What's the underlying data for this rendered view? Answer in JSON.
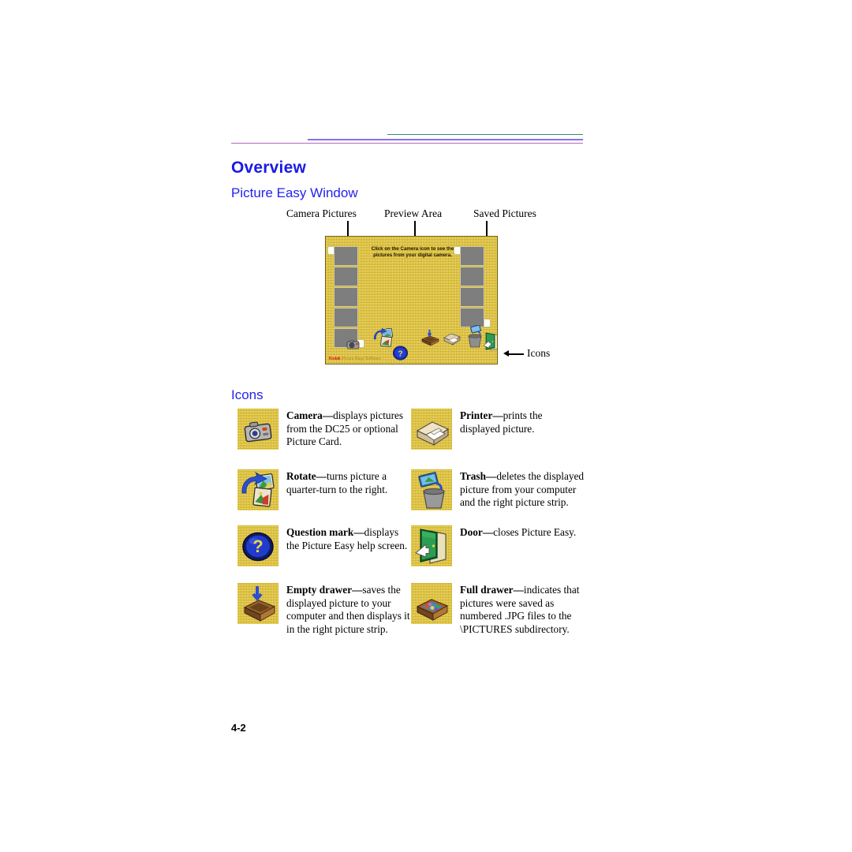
{
  "page": {
    "folio": "4-2"
  },
  "headings": {
    "overview": "Overview",
    "picture_easy_window": "Picture Easy Window",
    "icons": "Icons"
  },
  "colors": {
    "heading_blue": "#1a1ae6",
    "subheading_blue": "#2323f0",
    "rule_teal": "#2e8b86",
    "rule_blue": "#8a6fe8",
    "rule_mauve": "#b06ab8",
    "window_yellow": "#e8c425",
    "film_frame_gray": "#7e7e7e",
    "kodak_red": "#d81616"
  },
  "figure": {
    "callouts": {
      "camera_pictures": "Camera Pictures",
      "preview_area": "Preview Area",
      "saved_pictures": "Saved Pictures",
      "icons": "Icons"
    },
    "window": {
      "hint_text": "Click on the Camera icon to see the pictures from your digital camera.",
      "brand_mark": "Kodak",
      "brand_sub": "Picture Easy Software",
      "left_strip_frames": 5,
      "right_strip_frames": 4,
      "icon_order": [
        "camera-icon",
        "rotate-icon",
        "question-mark-icon",
        "empty-drawer-icon",
        "printer-icon",
        "trash-icon",
        "door-icon",
        "full-drawer-icon"
      ]
    }
  },
  "icon_legend": [
    {
      "left": {
        "icon": "camera-icon",
        "term": "Camera",
        "dash": "—",
        "description": "displays pictures from the DC25 or optional Picture Card."
      },
      "right": {
        "icon": "printer-icon",
        "term": "Printer",
        "dash": "—",
        "description": "prints the displayed picture."
      }
    },
    {
      "left": {
        "icon": "rotate-icon",
        "term": "Rotate",
        "dash": "—",
        "description": "turns picture a quarter-turn to the right."
      },
      "right": {
        "icon": "trash-icon",
        "term": "Trash",
        "dash": "—",
        "description": "deletes the displayed picture from your computer and the right picture strip."
      }
    },
    {
      "left": {
        "icon": "question-mark-icon",
        "term": "Question mark",
        "dash": "—",
        "description": "displays the Picture Easy help screen."
      },
      "right": {
        "icon": "door-icon",
        "term": "Door",
        "dash": "—",
        "description": "closes Picture Easy."
      }
    },
    {
      "left": {
        "icon": "empty-drawer-icon",
        "term": "Empty drawer",
        "dash": "—",
        "description": "saves the displayed picture to your computer and then displays it in the right picture strip."
      },
      "right": {
        "icon": "full-drawer-icon",
        "term": "Full drawer",
        "dash": "—",
        "description": "indicates that pictures were saved as numbered .JPG files to the \\PICTURES subdirectory."
      }
    }
  ]
}
